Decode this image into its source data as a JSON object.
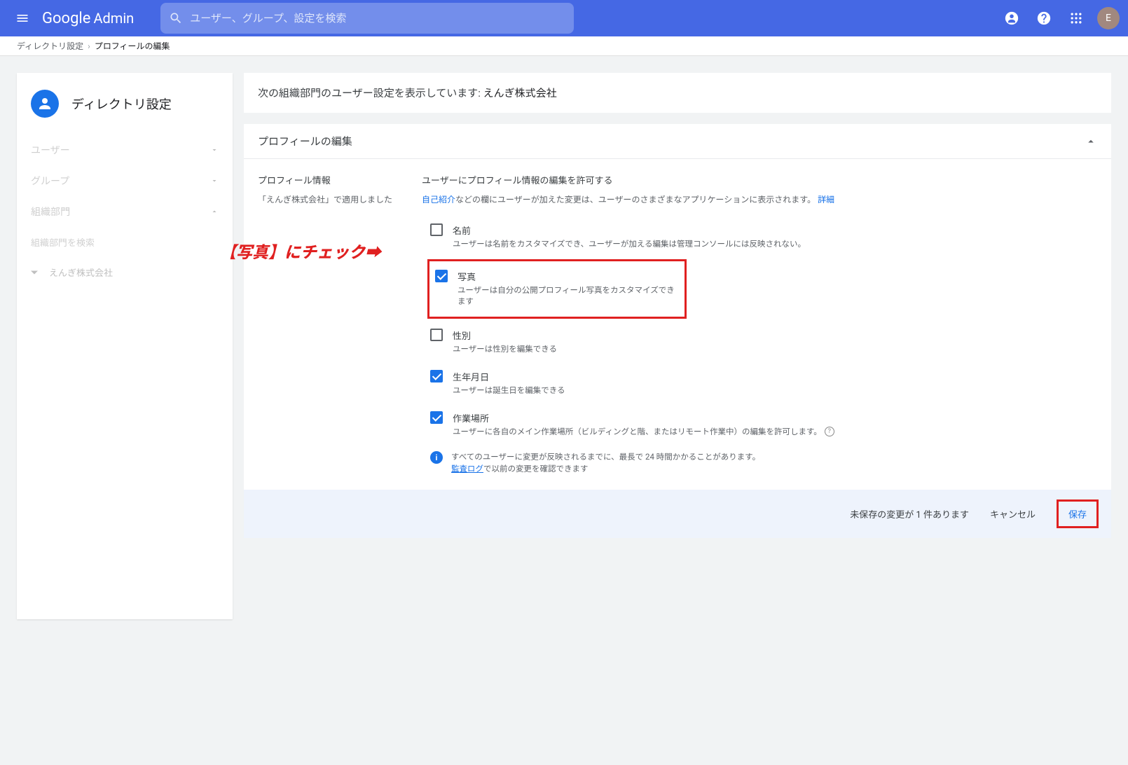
{
  "header": {
    "logo_google": "Google",
    "logo_admin": "Admin",
    "search_placeholder": "ユーザー、グループ、設定を検索",
    "avatar_initial": "E"
  },
  "breadcrumb": {
    "parent": "ディレクトリ設定",
    "current": "プロフィールの編集"
  },
  "sidebar": {
    "title": "ディレクトリ設定",
    "items": [
      {
        "label": "ユーザー"
      },
      {
        "label": "グループ"
      },
      {
        "label": "組織部門"
      }
    ],
    "ou_search_placeholder": "組織部門を検索",
    "org": "えんぎ株式会社"
  },
  "org_bar": {
    "prefix": "次の組織部門のユーザー設定を表示しています: ",
    "name": "えんぎ株式会社"
  },
  "panel": {
    "title": "プロフィールの編集",
    "left": {
      "title": "プロフィール情報",
      "applied": "「えんぎ株式会社」で適用しました"
    },
    "right": {
      "section_title": "ユーザーにプロフィール情報の編集を許可する",
      "desc_link": "自己紹介",
      "desc_rest": "などの欄にユーザーが加えた変更は、ユーザーのさまざまなアプリケーションに表示されます。",
      "detail_link": "詳細",
      "checks": [
        {
          "label": "名前",
          "desc": "ユーザーは名前をカスタマイズでき、ユーザーが加える編集は管理コンソールには反映されない。",
          "checked": false
        },
        {
          "label": "写真",
          "desc": "ユーザーは自分の公開プロフィール写真をカスタマイズできます",
          "checked": true
        },
        {
          "label": "性別",
          "desc": "ユーザーは性別を編集できる",
          "checked": false
        },
        {
          "label": "生年月日",
          "desc": "ユーザーは誕生日を編集できる",
          "checked": true
        },
        {
          "label": "作業場所",
          "desc": "ユーザーに各自のメイン作業場所（ビルディングと階、またはリモート作業中）の編集を許可します。",
          "checked": true,
          "help": true
        }
      ],
      "info_line1": "すべてのユーザーに変更が反映されるまでに、最長で 24 時間かかることがあります。",
      "info_link": "監査ログ",
      "info_line2": "で以前の変更を確認できます"
    }
  },
  "footer": {
    "unsaved": "未保存の変更が 1 件あります",
    "cancel": "キャンセル",
    "save": "保存"
  },
  "annotation": {
    "text": "【写真】にチェック➡"
  }
}
